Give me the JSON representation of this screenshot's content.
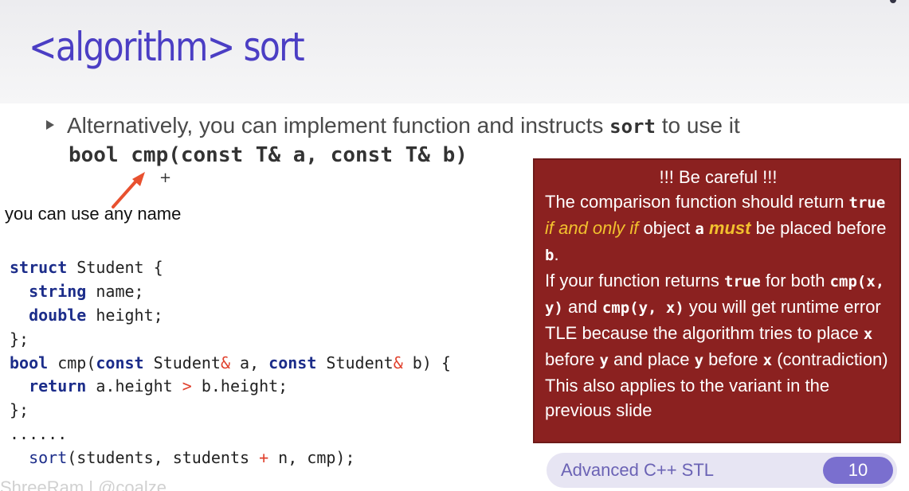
{
  "slide": {
    "title": "<algorithm> sort",
    "bullet": {
      "text_before": "Alternatively, you can implement function and instructs ",
      "keyword": "sort",
      "text_after": " to use it"
    },
    "signature": "bool cmp(const T& a, const T& b)",
    "annotation": "you can use any name",
    "code_lines": [
      [
        {
          "t": "struct",
          "c": "kw"
        },
        {
          "t": " Student {",
          "c": ""
        }
      ],
      [
        {
          "t": "  ",
          "c": ""
        },
        {
          "t": "string",
          "c": "kw"
        },
        {
          "t": " name;",
          "c": ""
        }
      ],
      [
        {
          "t": "  ",
          "c": ""
        },
        {
          "t": "double",
          "c": "kw"
        },
        {
          "t": " height;",
          "c": ""
        }
      ],
      [
        {
          "t": "};",
          "c": ""
        }
      ],
      [
        {
          "t": "bool",
          "c": "kw"
        },
        {
          "t": " cmp(",
          "c": ""
        },
        {
          "t": "const",
          "c": "kw"
        },
        {
          "t": " Student",
          "c": ""
        },
        {
          "t": "&",
          "c": "op"
        },
        {
          "t": " a, ",
          "c": ""
        },
        {
          "t": "const",
          "c": "kw"
        },
        {
          "t": " Student",
          "c": ""
        },
        {
          "t": "&",
          "c": "op"
        },
        {
          "t": " b) {",
          "c": ""
        }
      ],
      [
        {
          "t": "  ",
          "c": ""
        },
        {
          "t": "return",
          "c": "kw"
        },
        {
          "t": " a.height ",
          "c": ""
        },
        {
          "t": ">",
          "c": "op"
        },
        {
          "t": " b.height;",
          "c": ""
        }
      ],
      [
        {
          "t": "};",
          "c": ""
        }
      ],
      [
        {
          "t": "......",
          "c": ""
        }
      ],
      [
        {
          "t": "  ",
          "c": ""
        },
        {
          "t": "sort",
          "c": "fn"
        },
        {
          "t": "(students, students ",
          "c": ""
        },
        {
          "t": "+",
          "c": "op"
        },
        {
          "t": " n, cmp);",
          "c": ""
        }
      ]
    ],
    "callout": {
      "title": "!!! Be careful !!!",
      "p1_a": "The comparison function should return ",
      "p1_true": "true",
      "p1_iff": " if and only if",
      "p1_b": " object ",
      "p1_a_var": "a",
      "p1_must": " must",
      "p1_c": " be placed before ",
      "p1_b_var": "b",
      "p1_end": ".",
      "p2_a": "If your function returns ",
      "p2_true": "true",
      "p2_b": " for both ",
      "p2_cmp1": "cmp(x, y)",
      "p2_c": " and ",
      "p2_cmp2": "cmp(y, x)",
      "p2_d": "  you will get runtime error TLE because the algorithm tries to place ",
      "p2_x1": "x",
      "p2_e": " before ",
      "p2_y1": "y",
      "p2_f": " and place ",
      "p2_y2": "y",
      "p2_g": " before ",
      "p2_x2": "x",
      "p2_h": " (contradiction)",
      "p3": "This also applies to the variant in the previous slide"
    },
    "footer": {
      "label": "Advanced C++ STL",
      "page": "10"
    },
    "watermark": "ShreeRam | @coalze"
  },
  "colors": {
    "title": "#4b3ec4",
    "callout_bg": "#8b2120",
    "highlight_yellow": "#f2c12e",
    "arrow_red": "#e8512f",
    "footer_badge": "#7a6fcf"
  }
}
